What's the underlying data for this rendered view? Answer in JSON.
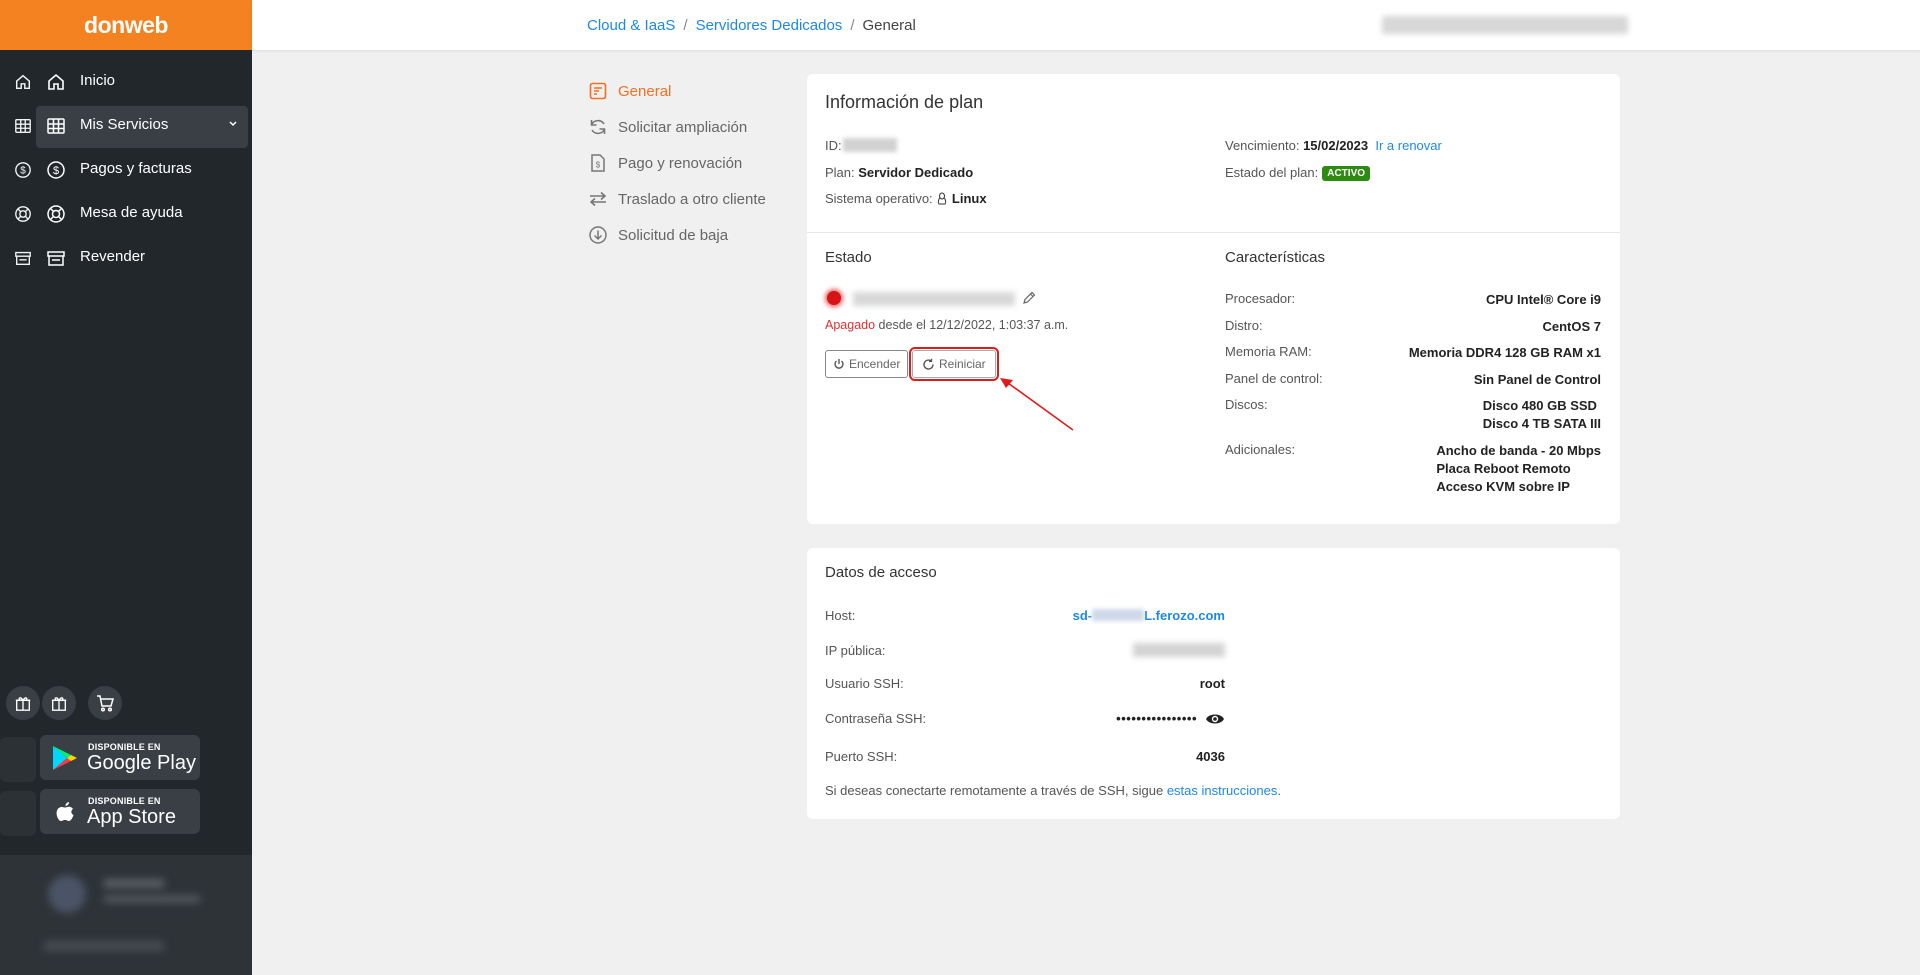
{
  "brand": {
    "logo": "donweb",
    "accent": "#f58220",
    "sidebar_bg": "#22272c"
  },
  "sidebar": {
    "items": [
      {
        "label": "Inicio",
        "icon": "home-icon"
      },
      {
        "label": "Mis Servicios",
        "icon": "grid-icon",
        "active": true
      },
      {
        "label": "Pagos y facturas",
        "icon": "dollar-circle-icon"
      },
      {
        "label": "Mesa de ayuda",
        "icon": "lifebuoy-icon"
      },
      {
        "label": "Revender",
        "icon": "store-icon"
      }
    ],
    "stores": [
      {
        "small": "DISPONIBLE EN",
        "big": "Google Play",
        "icon": "google-play-icon"
      },
      {
        "small": "DISPONIBLE EN",
        "big": "App Store",
        "icon": "apple-icon"
      }
    ]
  },
  "breadcrumb": {
    "items": [
      "Cloud & IaaS",
      "Servidores Dedicados"
    ],
    "current": "General",
    "separator": "/"
  },
  "submenu": {
    "items": [
      {
        "label": "General",
        "icon": "document-icon",
        "active": true
      },
      {
        "label": "Solicitar ampliación",
        "icon": "refresh-icon"
      },
      {
        "label": "Pago y renovación",
        "icon": "invoice-icon"
      },
      {
        "label": "Traslado a otro cliente",
        "icon": "transfer-icon"
      },
      {
        "label": "Solicitud de baja",
        "icon": "download-circle-icon"
      }
    ]
  },
  "plan": {
    "title": "Información de plan",
    "id_label": "ID:",
    "plan_label": "Plan:",
    "plan_value": "Servidor Dedicado",
    "os_label": "Sistema operativo:",
    "os_value": "Linux",
    "expiry_label": "Vencimiento:",
    "expiry_value": "15/02/2023",
    "renew_link": "Ir a renovar",
    "status_label": "Estado del plan:",
    "status_badge": "ACTIVO"
  },
  "estado": {
    "title": "Estado",
    "state": "Apagado",
    "since": "desde el 12/12/2022, 1:03:37 a.m.",
    "power_on_label": "Encender",
    "restart_label": "Reiniciar"
  },
  "caracteristicas": {
    "title": "Características",
    "rows": [
      {
        "label": "Procesador:",
        "values": [
          "CPU Intel® Core i9"
        ]
      },
      {
        "label": "Distro:",
        "values": [
          "CentOS 7"
        ]
      },
      {
        "label": "Memoria RAM:",
        "values": [
          "Memoria DDR4 128 GB RAM x1"
        ]
      },
      {
        "label": "Panel de control:",
        "values": [
          "Sin Panel de Control"
        ]
      },
      {
        "label": "Discos:",
        "values": [
          "Disco 480 GB SSD",
          "Disco 4 TB SATA III"
        ]
      },
      {
        "label": "Adicionales:",
        "values": [
          "Ancho de banda - 20 Mbps",
          "Placa Reboot Remoto",
          "Acceso KVM sobre IP"
        ]
      }
    ]
  },
  "acceso": {
    "title": "Datos de acceso",
    "host_label": "Host:",
    "host_prefix": "sd-",
    "host_suffix": "L.ferozo.com",
    "ip_label": "IP pública:",
    "user_label": "Usuario SSH:",
    "user_value": "root",
    "pass_label": "Contraseña SSH:",
    "pass_value": "••••••••••••••••",
    "port_label": "Puerto SSH:",
    "port_value": "4036",
    "note_prefix": "Si deseas conectarte remotamente a través de SSH, sigue",
    "note_link": "estas instrucciones",
    "note_suffix": "."
  }
}
